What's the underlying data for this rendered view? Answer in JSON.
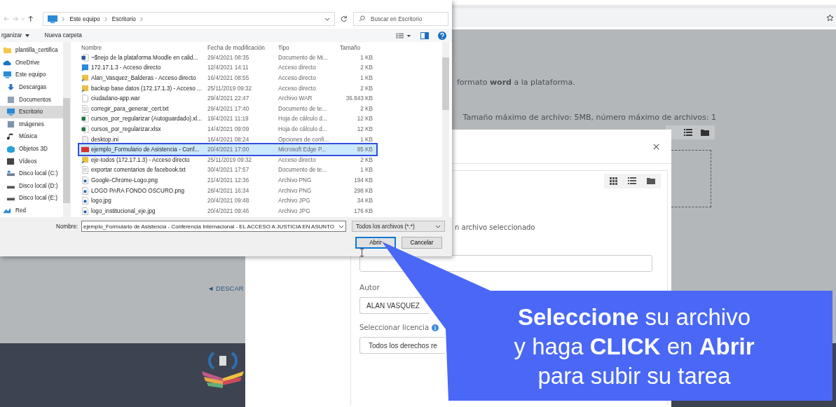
{
  "page": {
    "instruction": "formato **word** a la plataforma.",
    "limits": "Tamaño máximo de archivo: 5MB, número máximo de archivos: 1",
    "back_link": "◄ DESCAR"
  },
  "file_dialog": {
    "breadcrumb": [
      "Este equipo",
      "Escritorio"
    ],
    "search": {
      "placeholder": "Buscar en Escritorio"
    },
    "toolbar": {
      "organize": "rganizar",
      "new_folder": "Nueva carpeta"
    },
    "nav": [
      {
        "label": "plantilla_certifica",
        "kind": "folder",
        "selected": false
      },
      {
        "label": "OneDrive",
        "kind": "cloud",
        "selected": false
      },
      {
        "label": "Este equipo",
        "kind": "pc",
        "selected": false,
        "children": [
          {
            "label": "Descargas",
            "kind": "download",
            "selected": false
          },
          {
            "label": "Documentos",
            "kind": "doc",
            "selected": false
          },
          {
            "label": "Escritorio",
            "kind": "desktop",
            "selected": true
          },
          {
            "label": "Imágenes",
            "kind": "pictures",
            "selected": false
          },
          {
            "label": "Música",
            "kind": "music",
            "selected": false
          },
          {
            "label": "Objetos 3D",
            "kind": "cube",
            "selected": false
          },
          {
            "label": "Vídeos",
            "kind": "video",
            "selected": false
          },
          {
            "label": "Disco local (C:)",
            "kind": "osdrive",
            "selected": false
          },
          {
            "label": "Disco local (D:)",
            "kind": "drive",
            "selected": false
          },
          {
            "label": "Disco local (E:)",
            "kind": "drive",
            "selected": false
          }
        ]
      },
      {
        "label": "Red",
        "kind": "network",
        "selected": false
      }
    ],
    "columns": [
      "Nombre",
      "Fecha de modificación",
      "Tipo",
      "Tamaño"
    ],
    "rows": [
      {
        "kind": "word",
        "name": "~$nejo de la plataforma Moodle en calid...",
        "date": "29/4/2021 08:35",
        "type": "Documento de Mi...",
        "size": "1 KB",
        "selected": false
      },
      {
        "kind": "pc-shortcut",
        "name": "172.17.1.3 - Acceso directo",
        "date": "12/4/2021 14:11",
        "type": "Acceso directo",
        "size": "2 KB",
        "selected": false
      },
      {
        "kind": "shortcut",
        "name": "Alan_Vasquez_Balderas - Acceso directo",
        "date": "16/4/2021 08:55",
        "type": "Acceso directo",
        "size": "1 KB",
        "selected": false
      },
      {
        "kind": "shortcut",
        "name": "backup base datos (172.17.1.3) - Acceso ...",
        "date": "25/11/2019 09:32",
        "type": "Acceso directo",
        "size": "2 KB",
        "selected": false
      },
      {
        "kind": "file",
        "name": "ciudadano-app.war",
        "date": "29/4/2021 22:47",
        "type": "Archivo WAR",
        "size": "36.843 KB",
        "selected": false
      },
      {
        "kind": "text",
        "name": "corregir_para_generar_cert.txt",
        "date": "29/4/2021 17:40",
        "type": "Documento de te...",
        "size": "2 KB",
        "selected": false
      },
      {
        "kind": "excel",
        "name": "cursos_por_regularizar (Autoguardado).xl...",
        "date": "19/4/2021 11:19",
        "type": "Hoja de cálculo d...",
        "size": "12 KB",
        "selected": false
      },
      {
        "kind": "excel",
        "name": "cursos_por_regularizar.xlsx",
        "date": "14/4/2021 09:09",
        "type": "Hoja de cálculo d...",
        "size": "12 KB",
        "selected": false
      },
      {
        "kind": "settings",
        "name": "desktop.ini",
        "date": "16/4/2021 08:24",
        "type": "Opciones de confi...",
        "size": "1 KB",
        "selected": false
      },
      {
        "kind": "pdf",
        "name": "ejemplo_Formulario de Asistencia - Conf...",
        "date": "20/4/2021 17:00",
        "type": "Microsoft Edge P...",
        "size": "85 KB",
        "selected": true
      },
      {
        "kind": "shortcut",
        "name": "eje-todos (172.17.1.3) - Acceso directo",
        "date": "25/11/2019 09:32",
        "type": "Acceso directo",
        "size": "2 KB",
        "selected": false
      },
      {
        "kind": "text",
        "name": "exportar comentarios de facebook.txt",
        "date": "30/4/2021 17:57",
        "type": "Documento de te...",
        "size": "1 KB",
        "selected": false
      },
      {
        "kind": "image",
        "name": "Google-Chrome-Logo.png",
        "date": "21/4/2021 12:36",
        "type": "Archivo PNG",
        "size": "194 KB",
        "selected": false
      },
      {
        "kind": "image",
        "name": "LOGO PARA FONDO OSCURO.png",
        "date": "28/4/2021 16:34",
        "type": "Archivo PNG",
        "size": "298 KB",
        "selected": false
      },
      {
        "kind": "image",
        "name": "logo.jpg",
        "date": "20/4/2021 09:48",
        "type": "Archivo JPG",
        "size": "34 KB",
        "selected": false
      },
      {
        "kind": "image",
        "name": "logo_institucional_eje.jpg",
        "date": "20/4/2021 09:46",
        "type": "Archivo JPG",
        "size": "176 KB",
        "selected": false
      }
    ],
    "file_name": {
      "label": "Nombre:",
      "value": "ejemplo_Formulario de Asistencia - Conferencia Internacional - EL ACCESO A JUSTICIA EN ASUNTO"
    },
    "filter": "Todos los archivos (*.*)",
    "buttons": [
      {
        "label": "Abrir",
        "kind": "default"
      },
      {
        "label": "Cancelar",
        "kind": "normal"
      }
    ]
  },
  "upload_modal": {
    "status": "n archivo seleccionado",
    "author_label": "Autor",
    "author_value": "ALAN VASQUEZ",
    "license_label": "Seleccionar licencia",
    "license_value": "Todos los derechos re"
  },
  "callout": {
    "lines": [
      "**Seleccione** su archivo",
      "y haga **CLICK** en **Abrir**",
      "para subir su tarea"
    ]
  }
}
